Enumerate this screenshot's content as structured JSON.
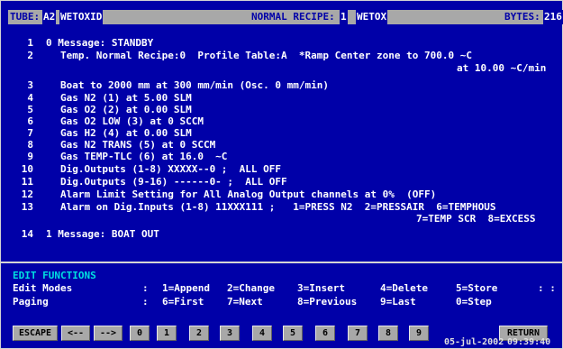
{
  "header": {
    "tube_label": "TUBE:",
    "tube_value": "A2",
    "tube_name": "WETOXID",
    "recipe_label": "NORMAL RECIPE:",
    "recipe_value": "1",
    "recipe_name": "WETOX",
    "bytes_label": "BYTES:",
    "bytes_value": "216"
  },
  "recipe_lines": [
    {
      "num": "1",
      "text": "0 Message: STANDBY"
    },
    {
      "num": "2",
      "text": "Temp. Normal Recipe:0  Profile Table:A  *Ramp Center zone to 700.0 ~C"
    },
    {
      "num": "",
      "text": "at 10.00 ~C/min"
    },
    {
      "num": "3",
      "text": "Boat to 2000 mm at 300 mm/min (Osc. 0 mm/min)"
    },
    {
      "num": "4",
      "text": "Gas N2 (1) at 5.00 SLM"
    },
    {
      "num": "5",
      "text": "Gas O2 (2) at 0.00 SLM"
    },
    {
      "num": "6",
      "text": "Gas O2 LOW (3) at 0 SCCM"
    },
    {
      "num": "7",
      "text": "Gas H2 (4) at 0.00 SLM"
    },
    {
      "num": "8",
      "text": "Gas N2 TRANS (5) at 0 SCCM"
    },
    {
      "num": "9",
      "text": "Gas TEMP-TLC (6) at 16.0  ~C"
    },
    {
      "num": "10",
      "text": "Dig.Outputs (1-8) XXXXX--0 ;  ALL OFF"
    },
    {
      "num": "11",
      "text": "Dig.Outputs (9-16) ------0- ;  ALL OFF"
    },
    {
      "num": "12",
      "text": "Alarm Limit Setting for All Analog Output channels at 0%  (OFF)"
    },
    {
      "num": "13",
      "text": "Alarm on Dig.Inputs (1-8) 11XXX111 ;   1=PRESS N2  2=PRESSAIR  6=TEMPHOUS"
    },
    {
      "num": "",
      "text": "7=TEMP SCR  8=EXCESS"
    },
    {
      "num": "14",
      "text": "1 Message: BOAT OUT"
    }
  ],
  "edit_functions": {
    "title": "EDIT FUNCTIONS",
    "modes_label": "Edit Modes",
    "modes_colon": ":",
    "modes": [
      "1=Append",
      "2=Change",
      "3=Insert",
      "4=Delete",
      "5=Store"
    ],
    "modes_extra": ": :",
    "paging_label": "Paging",
    "paging_colon": ":",
    "paging": [
      "6=First",
      "7=Next",
      "8=Previous",
      "9=Last",
      "0=Step"
    ]
  },
  "function_keys": [
    "ESCAPE",
    "<--",
    "-->",
    "0",
    "1",
    "2",
    "3",
    "4",
    "5",
    "6",
    "7",
    "8",
    "9",
    "RETURN"
  ],
  "status": {
    "date": "05-jul-2002",
    "time": "09:39:40"
  },
  "colors": {
    "background": "#0000a8",
    "header_bar": "#a8a8a8",
    "title": "#00e0e0"
  }
}
